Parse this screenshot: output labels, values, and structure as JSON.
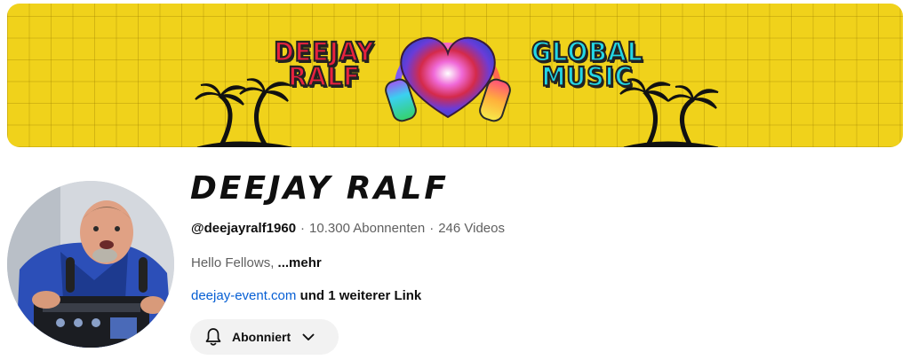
{
  "banner": {
    "left_text_line1": "DEEJAY",
    "left_text_line2": "RALF",
    "right_text_line1": "GLOBAL",
    "right_text_line2": "MUSIC",
    "background_color": "#f0d21b",
    "left_text_color": "#e8223f",
    "right_text_color": "#22d7e6"
  },
  "channel": {
    "title": "DEEJAY RALF",
    "handle": "@deejayralf1960",
    "subscribers": "10.300 Abonnenten",
    "videos": "246 Videos",
    "separator": "·",
    "description": "Hello Fellows,",
    "more_label": "...mehr",
    "link_text": "deejay-event.com",
    "more_links_text": "und 1 weiterer Link"
  },
  "subscribe": {
    "label": "Abonniert",
    "icon": "bell-icon",
    "dropdown_icon": "chevron-down-icon"
  },
  "colors": {
    "link": "#065fd4",
    "muted_text": "#606060",
    "button_bg": "#f2f2f2"
  }
}
